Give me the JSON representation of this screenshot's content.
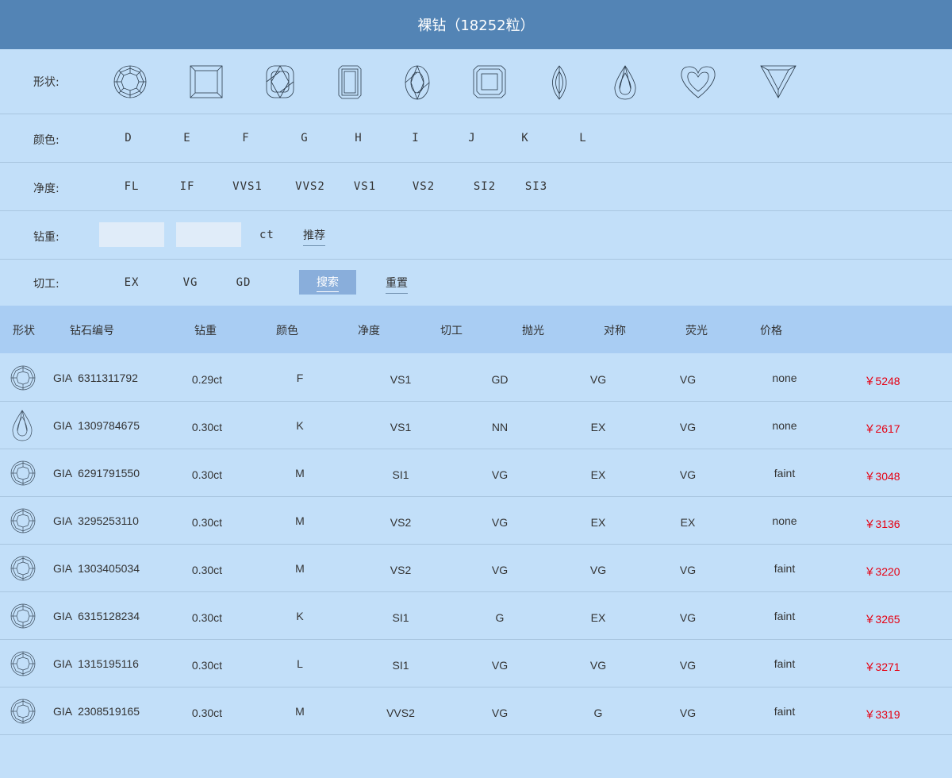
{
  "header": {
    "title": "裸钻（18252粒）"
  },
  "filters": {
    "shape": {
      "label": "形状:",
      "options": [
        "round",
        "princess",
        "cushion",
        "emerald",
        "oval",
        "radiant",
        "marquise",
        "pear",
        "heart",
        "triangle"
      ]
    },
    "color": {
      "label": "颜色:",
      "options": [
        "D",
        "E",
        "F",
        "G",
        "H",
        "I",
        "J",
        "K",
        "L"
      ]
    },
    "clarity": {
      "label": "净度:",
      "options": [
        "FL",
        "IF",
        "VVS1",
        "VVS2",
        "VS1",
        "VS2",
        "SI2",
        "SI3"
      ]
    },
    "weight": {
      "label": "钻重:",
      "min_value": "",
      "max_value": "",
      "unit": "ct",
      "recommend": "推荐"
    },
    "cut": {
      "label": "切工:",
      "options": [
        "EX",
        "VG",
        "GD"
      ],
      "search": "搜索",
      "reset": "重置"
    }
  },
  "table": {
    "headers": [
      "形状",
      "钻石编号",
      "钻重",
      "颜色",
      "净度",
      "切工",
      "抛光",
      "对称",
      "荧光",
      "价格"
    ],
    "rows": [
      {
        "shape": "round",
        "id": "GIA  6311311792",
        "weight": "0.29ct",
        "color": "F",
        "clarity": "VS1",
        "cut": "GD",
        "polish": "VG",
        "symmetry": "VG",
        "fluorescence": "none",
        "price": "￥5248"
      },
      {
        "shape": "pear",
        "id": "GIA  1309784675",
        "weight": "0.30ct",
        "color": "K",
        "clarity": "VS1",
        "cut": "NN",
        "polish": "EX",
        "symmetry": "VG",
        "fluorescence": "none",
        "price": "￥2617"
      },
      {
        "shape": "round",
        "id": "GIA  6291791550",
        "weight": "0.30ct",
        "color": "M",
        "clarity": "SI1",
        "cut": "VG",
        "polish": "EX",
        "symmetry": "VG",
        "fluorescence": "faint",
        "price": "￥3048"
      },
      {
        "shape": "round",
        "id": "GIA  3295253110",
        "weight": "0.30ct",
        "color": "M",
        "clarity": "VS2",
        "cut": "VG",
        "polish": "EX",
        "symmetry": "EX",
        "fluorescence": "none",
        "price": "￥3136"
      },
      {
        "shape": "round",
        "id": "GIA  1303405034",
        "weight": "0.30ct",
        "color": "M",
        "clarity": "VS2",
        "cut": "VG",
        "polish": "VG",
        "symmetry": "VG",
        "fluorescence": "faint",
        "price": "￥3220"
      },
      {
        "shape": "round",
        "id": "GIA  6315128234",
        "weight": "0.30ct",
        "color": "K",
        "clarity": "SI1",
        "cut": "G",
        "polish": "EX",
        "symmetry": "VG",
        "fluorescence": "faint",
        "price": "￥3265"
      },
      {
        "shape": "round",
        "id": "GIA  1315195116",
        "weight": "0.30ct",
        "color": "L",
        "clarity": "SI1",
        "cut": "VG",
        "polish": "VG",
        "symmetry": "VG",
        "fluorescence": "faint",
        "price": "￥3271"
      },
      {
        "shape": "round",
        "id": "GIA  2308519165",
        "weight": "0.30ct",
        "color": "M",
        "clarity": "VVS2",
        "cut": "VG",
        "polish": "G",
        "symmetry": "VG",
        "fluorescence": "faint",
        "price": "￥3319"
      }
    ]
  },
  "colors": {
    "header_bg": "#5384b5",
    "page_bg": "#c2dff9",
    "table_head_bg": "#a9cdf3",
    "price": "#e60012",
    "search_btn": "#89aedb"
  }
}
